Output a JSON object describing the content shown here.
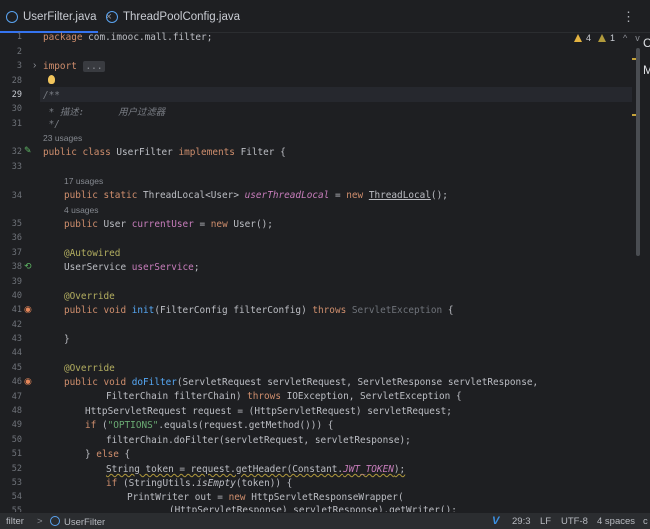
{
  "tabs": [
    {
      "label": "UserFilter.java",
      "active": true,
      "close": "×"
    },
    {
      "label": "ThreadPoolConfig.java",
      "active": false
    }
  ],
  "menu_icon": "⋮",
  "edge_letters": [
    "C",
    "M"
  ],
  "inspections": {
    "warnings": "4",
    "weak_warnings": "1",
    "up": "^",
    "down": "v"
  },
  "lines": {
    "l1": "1",
    "l2": "2",
    "l3": "3",
    "l28": "28",
    "l29": "29",
    "l30": "30",
    "l31": "31",
    "l32": "32",
    "l33": "33",
    "l34": "34",
    "l35": "35",
    "l36": "36",
    "l37": "37",
    "l38": "38",
    "l39": "39",
    "l40": "40",
    "l41": "41",
    "l42": "42",
    "l43": "43",
    "l44": "44",
    "l45": "45",
    "l46": "46",
    "l47": "47",
    "l48": "48",
    "l49": "49",
    "l50": "50",
    "l51": "51",
    "l52": "52",
    "l53": "53",
    "l54": "54",
    "l55": "55"
  },
  "code": {
    "package_kw": "package",
    "package_name": " com.imooc.mall.filter;",
    "import_kw": "import",
    "import_fold": "...",
    "doc_open": "/**",
    "doc_desc": " * 描述:      用户过滤器",
    "doc_close": " */",
    "usages_23": "23 usages",
    "class_kw": "public class",
    "class_name": " UserFilter ",
    "implements_kw": "implements",
    "filter_iface": " Filter {",
    "usages_17": "17 usages",
    "tl_kw": "public static",
    "tl_type": " ThreadLocal<User> ",
    "tl_field": "userThreadLocal",
    "tl_eq": " = ",
    "tl_new": "new",
    "tl_ctor": "ThreadLocal",
    "tl_end": "();",
    "usages_4": "4 usages",
    "cu_kw": "public",
    "cu_type": " User ",
    "cu_field": "currentUser",
    "cu_eq": " = ",
    "cu_new": "new",
    "cu_end": " User();",
    "autowired": "@Autowired",
    "us_type": "UserService ",
    "us_field": "userService",
    "us_end": ";",
    "override1": "@Override",
    "init_kw": "public void",
    "init_fn": "init",
    "init_args": "(FilterConfig filterConfig) ",
    "init_throws": "throws",
    "init_exc": " ServletException",
    "init_end": " {",
    "close_brace": "}",
    "override2": "@Override",
    "df_kw": "public void",
    "df_fn": "doFilter",
    "df_args": "(ServletRequest servletRequest, ServletResponse servletResponse,",
    "l47_a": "FilterChain filterChain) ",
    "l47_throws": "throws",
    "l47_b": " IOException, ServletException {",
    "l48": "HttpServletRequest request = (HttpServletRequest) servletRequest;",
    "l49_if": "if",
    "l49_a": " (",
    "l49_str": "\"OPTIONS\"",
    "l49_b": ".equals(request.getMethod())) {",
    "l50": "filterChain.doFilter(servletRequest, servletResponse);",
    "l51_a": "} ",
    "l51_else": "else",
    "l51_b": " {",
    "l52_a": "String token = request.getHeader(Constant.",
    "l52_const": "JWT_TOKEN",
    "l52_b": ");",
    "l53_if": "if",
    "l53_a": " (StringUtils.",
    "l53_fn": "isEmpty",
    "l53_b": "(token)) {",
    "l54_a": "PrintWriter out = ",
    "l54_new": "new",
    "l54_b": " HttpServletResponseWrapper(",
    "l55": "(HttpServletResponse) servletResponse).getWriter();"
  },
  "status": {
    "crumb1": "filter",
    "sep": ">",
    "crumb2": "UserFilter",
    "position": "29:3",
    "line_sep": "LF",
    "encoding": "UTF-8",
    "indent": "4 spaces",
    "edge": "c"
  },
  "colors": {
    "keyword": "#cf8e6d",
    "function": "#56a8f5",
    "field": "#c77dbb",
    "string": "#6aab73",
    "annotation": "#b3ae60",
    "accent": "#3574f0"
  }
}
